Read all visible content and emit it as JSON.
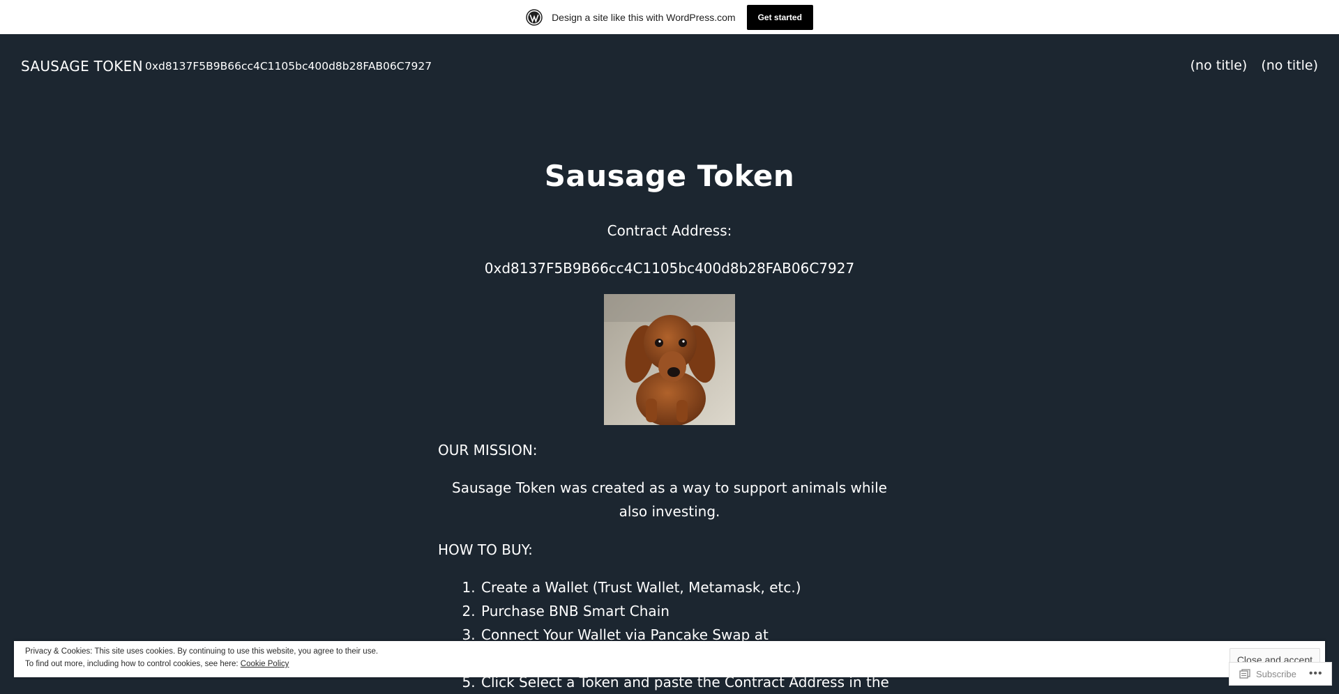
{
  "wp_banner": {
    "text": "Design a site like this with WordPress.com",
    "button": "Get started"
  },
  "header": {
    "site_title": "SAUSAGE TOKEN",
    "tagline": "0xd8137F5B9B66cc4C1105bc400d8b28FAB06C7927",
    "nav": [
      "(no title)",
      "(no title)"
    ]
  },
  "content": {
    "title": "Sausage Token",
    "contract_label": "Contract Address:",
    "contract_address": "0xd8137F5B9B66cc4C1105bc400d8b28FAB06C7927",
    "mission_heading": "OUR MISSION:",
    "mission_text": "Sausage Token was created as a way to support animals while also investing.",
    "how_heading": "HOW TO BUY:",
    "steps": [
      "Create a Wallet (Trust Wallet, Metamask, etc.)",
      "Purchase BNB Smart Chain",
      "Connect Your Wallet via Pancake Swap at",
      "Click Select a Token and paste the Contract Address in the"
    ]
  },
  "cookie_banner": {
    "line1": "Privacy & Cookies: This site uses cookies. By continuing to use this website, you agree to their use.",
    "line2": "To find out more, including how to control cookies, see here:",
    "link": "Cookie Policy",
    "button": "Close and accept"
  },
  "subscribe": {
    "label": "Subscribe",
    "more": "•••"
  },
  "colors": {
    "background": "#1c2630",
    "text": "#ffffff"
  }
}
